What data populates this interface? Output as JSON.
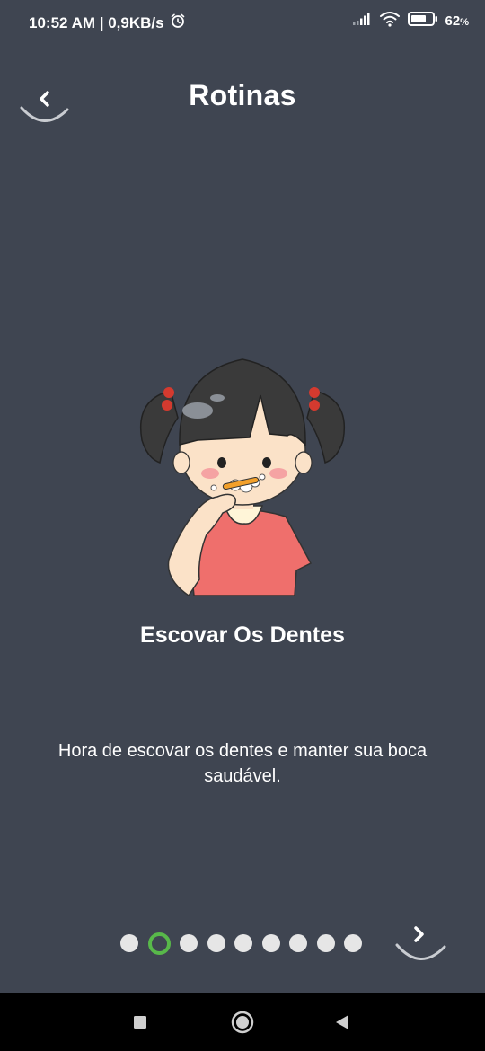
{
  "status_bar": {
    "time_speed": "10:52 AM | 0,9KB/s",
    "battery_percent": "62",
    "battery_suffix": "%",
    "icons": [
      "alarm-icon",
      "signal-icon",
      "wifi-icon",
      "battery-icon"
    ]
  },
  "header": {
    "title": "Rotinas",
    "back_icon": "chevron-left-icon"
  },
  "routine": {
    "illustration": "girl-brushing-teeth",
    "title": "Escovar Os Dentes",
    "description": "Hora de escovar os dentes e manter sua boca saudável."
  },
  "pager": {
    "total": 9,
    "current": 2,
    "active_color": "#58b84a",
    "dot_color": "#e6e6e6",
    "next_icon": "chevron-right-icon"
  },
  "nav_bar": {
    "buttons": [
      "recents-square-icon",
      "home-circle-icon",
      "back-triangle-icon"
    ]
  },
  "colors": {
    "background": "#3f4551",
    "text": "#ffffff"
  }
}
